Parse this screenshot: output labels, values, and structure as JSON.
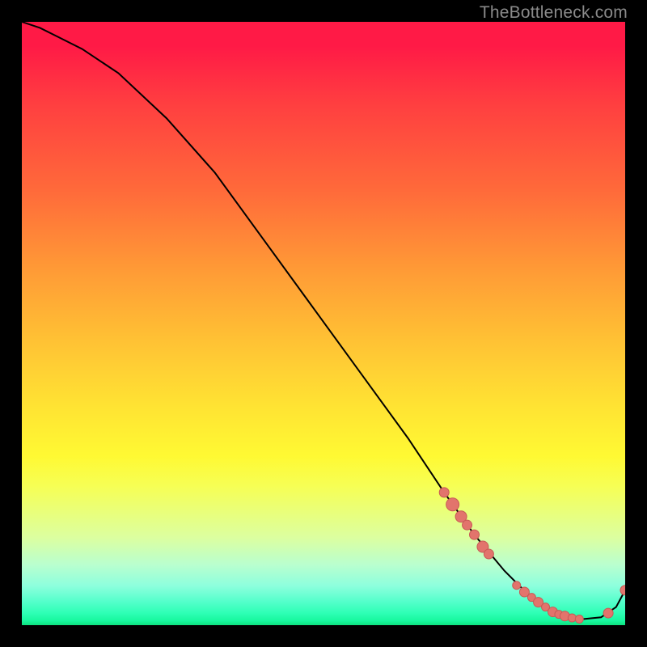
{
  "watermark": {
    "text": "TheBottleneck.com"
  },
  "colors": {
    "line": "#000000",
    "dot_fill": "#e2746c",
    "dot_stroke": "#c85a56"
  },
  "chart_data": {
    "type": "line",
    "title": "",
    "xlabel": "",
    "ylabel": "",
    "xlim": [
      0,
      100
    ],
    "ylim": [
      0,
      100
    ],
    "grid": false,
    "legend": false,
    "series": [
      {
        "name": "curve",
        "x": [
          0,
          3,
          6,
          10,
          16,
          24,
          32,
          40,
          48,
          56,
          64,
          70,
          75,
          80,
          84,
          87,
          90,
          93,
          96,
          98.5,
          100
        ],
        "y": [
          100,
          99,
          97.5,
          95.5,
          91.5,
          84,
          75,
          64,
          53,
          42,
          31,
          22,
          15,
          9,
          5,
          3,
          1.5,
          1.0,
          1.3,
          3.0,
          5.8
        ]
      }
    ],
    "markers": [
      {
        "x": 70.0,
        "y": 22.0,
        "r": 6
      },
      {
        "x": 71.4,
        "y": 20.0,
        "r": 8
      },
      {
        "x": 72.8,
        "y": 18.0,
        "r": 7
      },
      {
        "x": 73.8,
        "y": 16.6,
        "r": 6
      },
      {
        "x": 75.0,
        "y": 15.0,
        "r": 6
      },
      {
        "x": 76.4,
        "y": 13.0,
        "r": 7
      },
      {
        "x": 77.4,
        "y": 11.8,
        "r": 6
      },
      {
        "x": 82.0,
        "y": 6.6,
        "r": 5
      },
      {
        "x": 83.3,
        "y": 5.5,
        "r": 6
      },
      {
        "x": 84.5,
        "y": 4.6,
        "r": 5
      },
      {
        "x": 85.6,
        "y": 3.8,
        "r": 6
      },
      {
        "x": 86.8,
        "y": 3.0,
        "r": 5
      },
      {
        "x": 88.0,
        "y": 2.2,
        "r": 6
      },
      {
        "x": 89.0,
        "y": 1.8,
        "r": 5
      },
      {
        "x": 90.0,
        "y": 1.5,
        "r": 6
      },
      {
        "x": 91.2,
        "y": 1.2,
        "r": 5
      },
      {
        "x": 92.4,
        "y": 1.0,
        "r": 5
      },
      {
        "x": 97.2,
        "y": 2.0,
        "r": 6
      },
      {
        "x": 100.0,
        "y": 5.8,
        "r": 6
      }
    ]
  }
}
